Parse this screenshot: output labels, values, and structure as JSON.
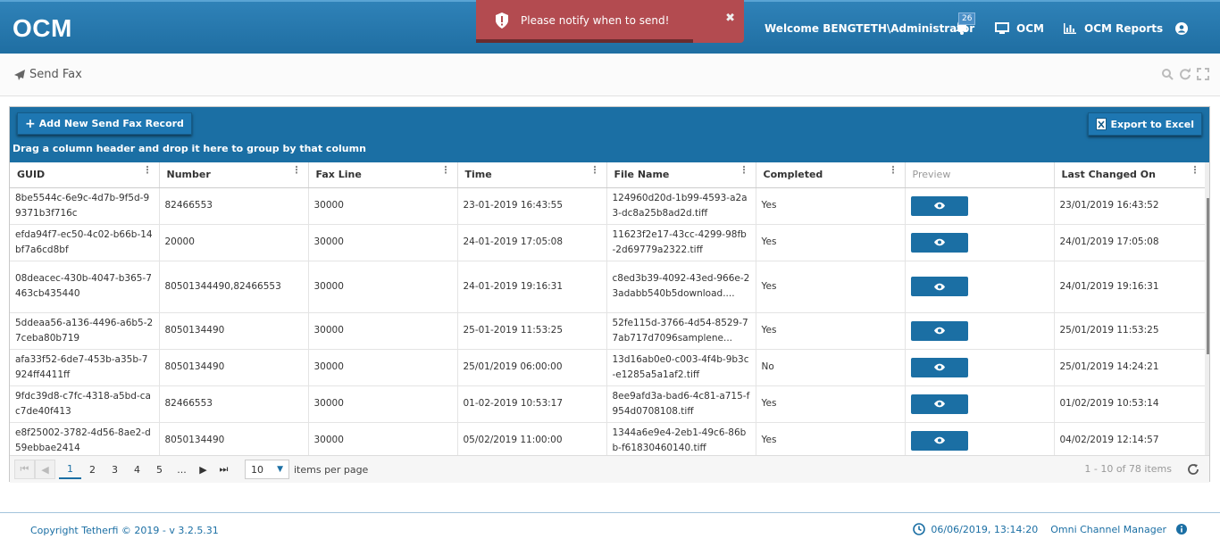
{
  "header": {
    "logo": "OCM",
    "welcome_prefix": "Welcome ",
    "user": "BENGTETH\\Administrator",
    "notification_count": "26",
    "ocm_link": "OCM",
    "reports_link": "OCM Reports"
  },
  "toast": {
    "message": "Please notify when to send!",
    "close": "✖"
  },
  "page": {
    "title": "Send Fax"
  },
  "toolbar": {
    "add_label": "Add New Send Fax Record",
    "export_label": "Export to Excel",
    "group_hint": "Drag a column header and drop it here to group by that column"
  },
  "columns": [
    "GUID",
    "Number",
    "Fax Line",
    "Time",
    "File Name",
    "Completed",
    "Preview",
    "Last Changed On"
  ],
  "rows": [
    {
      "guid": "8be5544c-6e9c-4d7b-9f5d-99371b3f716c",
      "number": "82466553",
      "faxline": "30000",
      "time": "23-01-2019 16:43:55",
      "file": "124960d20d-1b99-4593-a2a3-dc8a25b8ad2d.tiff",
      "completed": "Yes",
      "changed": "23/01/2019 16:43:52"
    },
    {
      "guid": "efda94f7-ec50-4c02-b66b-14bf7a6cd8bf",
      "number": "20000",
      "faxline": "30000",
      "time": "24-01-2019 17:05:08",
      "file": "11623f2e17-43cc-4299-98fb-2d69779a2322.tiff",
      "completed": "Yes",
      "changed": "24/01/2019 17:05:08"
    },
    {
      "guid": "08deacec-430b-4047-b365-7463cb435440",
      "number": "80501344490,82466553",
      "faxline": "30000",
      "time": "24-01-2019 19:16:31",
      "file": "c8ed3b39-4092-43ed-966e-23adabb540b5download....",
      "completed": "Yes",
      "changed": "24/01/2019 19:16:31"
    },
    {
      "guid": "5ddeaa56-a136-4496-a6b5-27ceba80b719",
      "number": "8050134490",
      "faxline": "30000",
      "time": "25-01-2019 11:53:25",
      "file": "52fe115d-3766-4d54-8529-77ab717d7096samplene...",
      "completed": "Yes",
      "changed": "25/01/2019 11:53:25"
    },
    {
      "guid": "afa33f52-6de7-453b-a35b-7924ff4411ff",
      "number": "8050134490",
      "faxline": "30000",
      "time": "25/01/2019 06:00:00",
      "file": "13d16ab0e0-c003-4f4b-9b3c-e1285a5a1af2.tiff",
      "completed": "No",
      "changed": "25/01/2019 14:24:21"
    },
    {
      "guid": "9fdc39d8-c7fc-4318-a5bd-cac7de40f413",
      "number": "82466553",
      "faxline": "30000",
      "time": "01-02-2019 10:53:17",
      "file": "8ee9afd3a-bad6-4c81-a715-f954d0708108.tiff",
      "completed": "Yes",
      "changed": "01/02/2019 10:53:14"
    },
    {
      "guid": "e8f25002-3782-4d56-8ae2-d59ebbae2414",
      "number": "8050134490",
      "faxline": "30000",
      "time": "05/02/2019 11:00:00",
      "file": "1344a6e9e4-2eb1-49c6-86bb-f61830460140.tiff",
      "completed": "Yes",
      "changed": "04/02/2019 12:14:57"
    }
  ],
  "pager": {
    "pages": [
      "1",
      "2",
      "3",
      "4",
      "5",
      "..."
    ],
    "page_size": "10",
    "per_page_label": "items per page",
    "summary": "1 - 10 of 78 items"
  },
  "footer": {
    "copyright": "Copyright Tetherfi © 2019 - v 3.2.5.31",
    "datetime": "06/06/2019, 13:14:20",
    "product": "Omni Channel Manager"
  }
}
